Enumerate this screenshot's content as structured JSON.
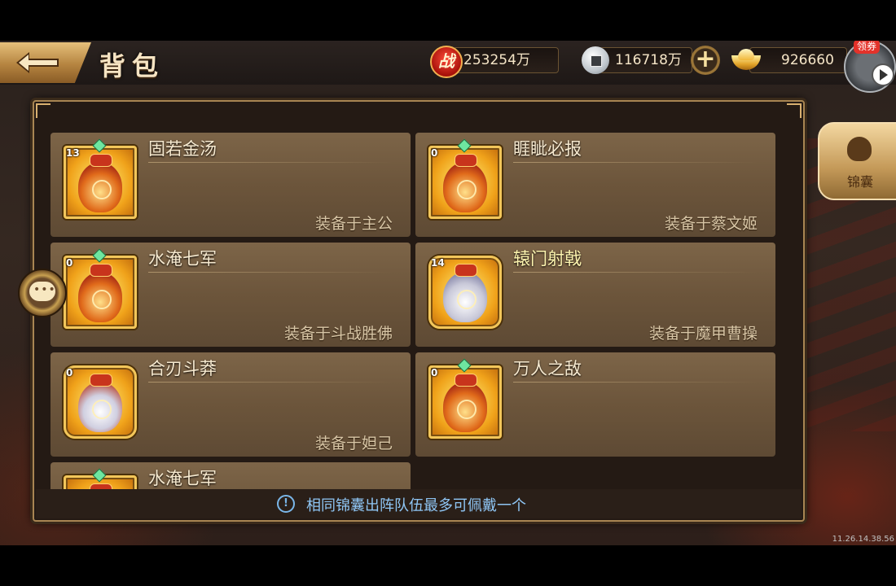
{
  "header": {
    "title": "背包",
    "power": {
      "icon": "zhan-power-icon",
      "icon_text": "战",
      "value": "253254万"
    },
    "silver": {
      "icon": "silver-coin-icon",
      "value": "116718万"
    },
    "gold": {
      "icon": "gold-ingot-icon",
      "value": "926660"
    },
    "coupon": {
      "tag": "领券"
    }
  },
  "items": [
    {
      "name": "固若金汤",
      "count": "13",
      "equip": "装备于主公",
      "bag": "red",
      "frame": "orange"
    },
    {
      "name": "睚眦必报",
      "count": "0",
      "equip": "装备于蔡文姬",
      "bag": "red",
      "frame": "orange"
    },
    {
      "name": "水淹七军",
      "count": "0",
      "equip": "装备于斗战胜佛",
      "bag": "red",
      "frame": "orange"
    },
    {
      "name": "辕门射戟",
      "count": "14",
      "equip": "装备于魔甲曹操",
      "bag": "silver",
      "frame": "purple"
    },
    {
      "name": "合刃斗莽",
      "count": "0",
      "equip": "装备于妲己",
      "bag": "redsilver",
      "frame": "purple"
    },
    {
      "name": "万人之敌",
      "count": "0",
      "equip": "",
      "bag": "red",
      "frame": "orange"
    },
    {
      "name": "水淹七军",
      "count": "",
      "equip": "",
      "bag": "red",
      "frame": "orange"
    }
  ],
  "footer": {
    "tip": "相同锦囊出阵队伍最多可佩戴一个"
  },
  "side_tab": {
    "label": "锦囊"
  },
  "timestamp": "11.26.14.38.56",
  "colors": {
    "accent_gold": "#f2c65a",
    "tip_blue": "#8fc6f5",
    "card_brown": "#6c553b"
  }
}
